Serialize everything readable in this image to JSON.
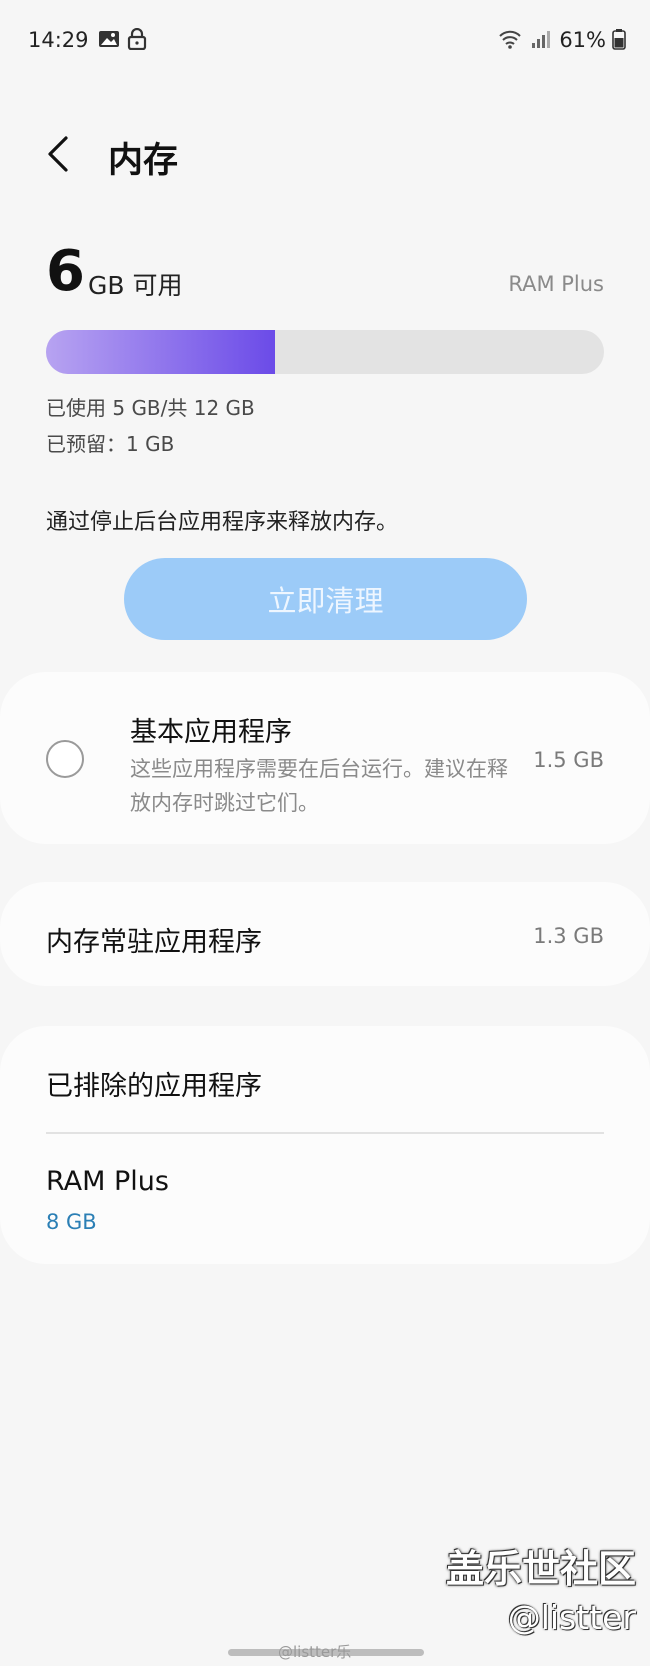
{
  "status_bar": {
    "time": "14:29",
    "battery": "61%",
    "icons": [
      "image-icon",
      "lock-icon",
      "wifi-icon",
      "signal-icon",
      "battery-icon"
    ]
  },
  "header": {
    "title": "内存"
  },
  "memory": {
    "available_number": "6",
    "available_unit": "GB 可用",
    "ram_plus_link": "RAM Plus",
    "used_fraction": 0.41,
    "used_text": "已使用 5 GB/共 12 GB",
    "reserved_text": "已预留：1 GB",
    "bar_colors": {
      "start": "#b7a3f1",
      "end": "#6b4be8",
      "track": "#e3e3e3"
    }
  },
  "cleanup": {
    "hint": "通过停止后台应用程序来释放内存。",
    "button_label": "立即清理"
  },
  "basic_apps": {
    "title": "基本应用程序",
    "description": "这些应用程序需要在后台运行。建议在释放内存时跳过它们。",
    "size": "1.5 GB",
    "checked": false
  },
  "resident_apps": {
    "title": "内存常驻应用程序",
    "size": "1.3 GB"
  },
  "excluded_apps": {
    "title": "已排除的应用程序"
  },
  "ram_plus": {
    "title": "RAM Plus",
    "value": "8 GB"
  },
  "watermark": {
    "forum": "盖乐世社区",
    "handle": "@listter",
    "weibo": "@listter乐"
  },
  "colors": {
    "accent_blue": "#9ccbf8",
    "link_blue": "#2b7fb5",
    "background": "#f6f6f6"
  }
}
